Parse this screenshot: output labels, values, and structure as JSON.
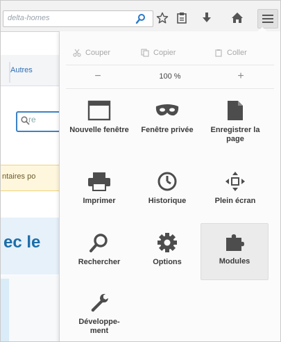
{
  "toolbar": {
    "url_text": "delta-homes",
    "icons": [
      "search-icon",
      "star-icon",
      "clipboard-icon",
      "download-icon",
      "home-icon",
      "hamburger-menu-icon"
    ]
  },
  "background_page": {
    "tab_label": "Autres",
    "search_placeholder": "re",
    "banner_text": "ntaires po",
    "heading_text": "ec le"
  },
  "menu": {
    "edit": {
      "cut": "Couper",
      "copy": "Copier",
      "paste": "Coller"
    },
    "zoom": {
      "minus": "−",
      "value": "100 %",
      "plus": "+"
    },
    "items": [
      {
        "label": "Nouvelle fenêtre",
        "icon": "window-icon"
      },
      {
        "label": "Fenêtre privée",
        "icon": "mask-icon"
      },
      {
        "label": "Enregistrer la page",
        "icon": "page-icon"
      },
      {
        "label": "Imprimer",
        "icon": "printer-icon"
      },
      {
        "label": "Historique",
        "icon": "clock-icon"
      },
      {
        "label": "Plein écran",
        "icon": "fullscreen-icon"
      },
      {
        "label": "Rechercher",
        "icon": "magnifier-icon"
      },
      {
        "label": "Options",
        "icon": "gear-icon"
      },
      {
        "label": "Modules",
        "icon": "puzzle-icon"
      },
      {
        "label": "Développe-ment",
        "icon": "wrench-icon"
      }
    ]
  },
  "colors": {
    "panel_bg": "#fbfbfb",
    "accent_blue": "#1b6ea8",
    "icon_gray": "#5a5a5a"
  }
}
